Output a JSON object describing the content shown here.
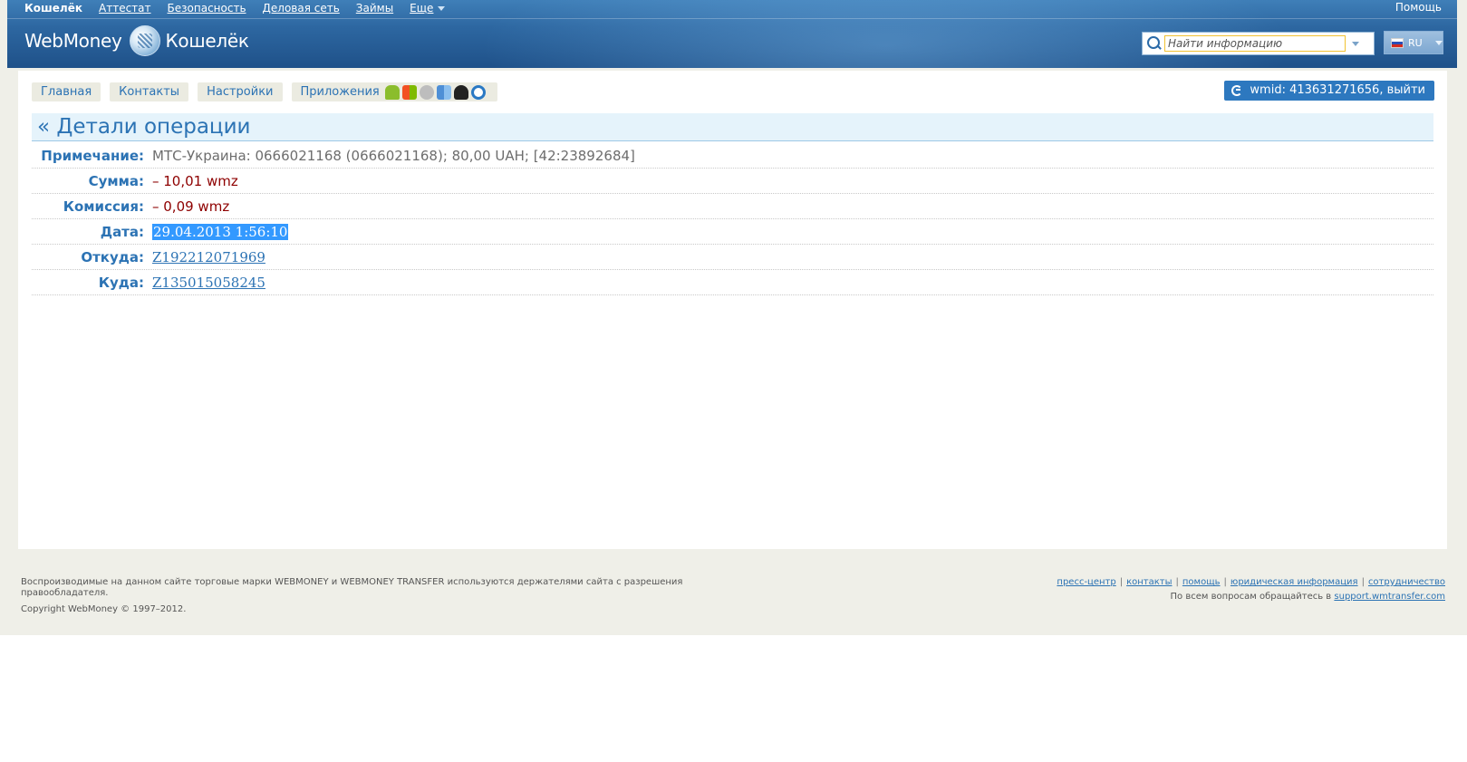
{
  "topnav": {
    "items": [
      "Кошелёк",
      "Аттестат",
      "Безопасность",
      "Деловая сеть",
      "Займы",
      "Еще"
    ],
    "help": "Помощь"
  },
  "brand": {
    "name": "WebMoney",
    "product": "Кошелёк"
  },
  "search": {
    "placeholder": "Найти информацию"
  },
  "lang": {
    "code": "RU"
  },
  "tabs": [
    "Главная",
    "Контакты",
    "Настройки",
    "Приложения"
  ],
  "app_icons": [
    "android-icon",
    "windows-icon",
    "apple-icon",
    "mac-icon",
    "linux-icon",
    "web-icon"
  ],
  "account": {
    "wmid_label": "wmid: 413631271656, выйти"
  },
  "page": {
    "title": "« Детали операции"
  },
  "details": [
    {
      "label": "Примечание:",
      "value": "МТС-Украина: 0666021168 (0666021168); 80,00 UAH; [42:23892684]"
    },
    {
      "label": "Сумма:",
      "value": "– 10,01 wmz"
    },
    {
      "label": "Комиссия:",
      "value": "– 0,09 wmz"
    },
    {
      "label": "Дата:",
      "value": "29.04.2013 1:56:10"
    },
    {
      "label": "Откуда:",
      "value": "Z192212071969"
    },
    {
      "label": "Куда:",
      "value": "Z135015058245"
    }
  ],
  "footer": {
    "trademark": "Воспроизводимые на данном сайте торговые марки WEBMONEY и WEBMONEY TRANSFER используются держателями сайта с разрешения правообладателя.",
    "copyright": "Copyright WebMoney © 1997–2012.",
    "links": [
      "пресс-центр",
      "контакты",
      "помощь",
      "юридическая информация",
      "сотрудничество"
    ],
    "support_text": "По всем вопросам обращайтесь в",
    "support_link": "support.wmtransfer.com"
  },
  "colors": {
    "brand_blue": "#2c73b4",
    "header_blue": "#2d67a1",
    "negative": "#8e0000",
    "selection": "#3399ff"
  }
}
